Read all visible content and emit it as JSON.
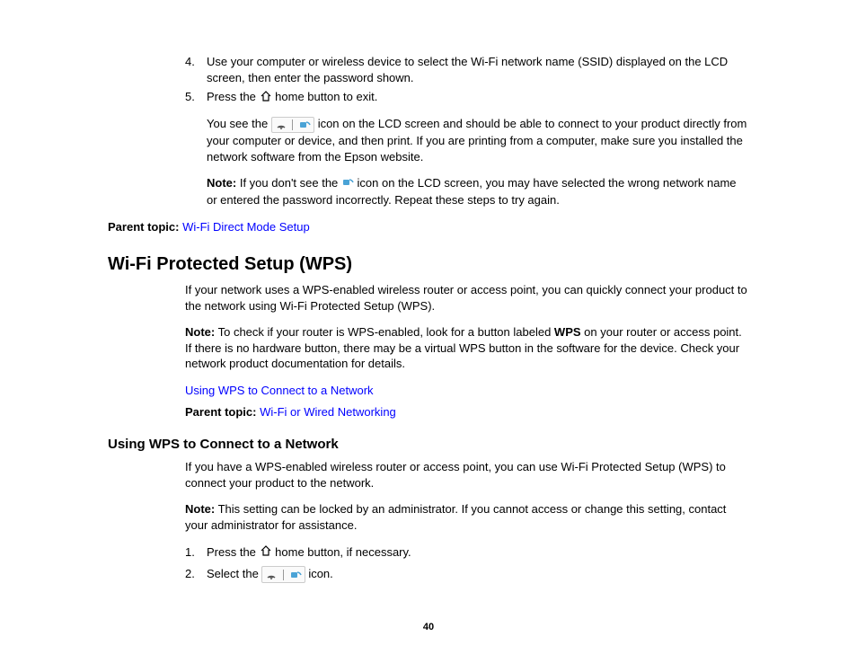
{
  "steps_top": [
    {
      "num": "4.",
      "text": "Use your computer or wireless device to select the Wi-Fi network name (SSID) displayed on the LCD screen, then enter the password shown."
    },
    {
      "num": "5.",
      "text_before": "Press the ",
      "text_after": " home button to exit."
    }
  ],
  "after_step5": {
    "p1_a": "You see the ",
    "p1_b": " icon on the LCD screen and should be able to connect to your product directly from your computer or device, and then print. If you are printing from a computer, make sure you installed the network software from the Epson website.",
    "note_label": "Note:",
    "note_a": " If you don't see the ",
    "note_b": " icon on the LCD screen, you may have selected the wrong network name or entered the password incorrectly. Repeat these steps to try again."
  },
  "parent_topic1": {
    "label": "Parent topic:",
    "link": "Wi-Fi Direct Mode Setup"
  },
  "wps": {
    "heading": "Wi-Fi Protected Setup (WPS)",
    "intro": "If your network uses a WPS-enabled wireless router or access point, you can quickly connect your product to the network using Wi-Fi Protected Setup (WPS).",
    "note_label": "Note:",
    "note_a": " To check if your router is WPS-enabled, look for a button labeled ",
    "note_wps": "WPS",
    "note_b": " on your router or access point. If there is no hardware button, there may be a virtual WPS button in the software for the device. Check your network product documentation for details.",
    "link1": "Using WPS to Connect to a Network",
    "parent_label": "Parent topic:",
    "parent_link": "Wi-Fi or Wired Networking"
  },
  "using_wps": {
    "heading": "Using WPS to Connect to a Network",
    "intro": "If you have a WPS-enabled wireless router or access point, you can use Wi-Fi Protected Setup (WPS) to connect your product to the network.",
    "note_label": "Note:",
    "note_text": " This setting can be locked by an administrator. If you cannot access or change this setting, contact your administrator for assistance.",
    "steps": [
      {
        "num": "1.",
        "text_before": "Press the ",
        "text_after": " home button, if necessary."
      },
      {
        "num": "2.",
        "text_before": "Select the ",
        "text_after": " icon."
      }
    ]
  },
  "page_number": "40"
}
